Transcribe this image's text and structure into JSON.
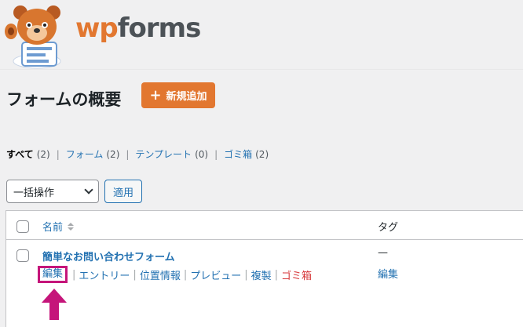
{
  "brand": {
    "part1": "wp",
    "part2": "forms"
  },
  "page": {
    "title": "フォームの概要",
    "add_new_label": "新規追加"
  },
  "filters": [
    {
      "label": "すべて",
      "count": "(2)",
      "current": true
    },
    {
      "label": "フォーム",
      "count": "(2)",
      "current": false
    },
    {
      "label": "テンプレート",
      "count": "(0)",
      "current": false
    },
    {
      "label": "ゴミ箱",
      "count": "(2)",
      "current": false
    }
  ],
  "bulk_actions": {
    "selected": "一括操作",
    "apply_label": "適用"
  },
  "table": {
    "columns": {
      "name": "名前",
      "tags": "タグ"
    },
    "rows": [
      {
        "title": "簡単なお問い合わせフォーム",
        "tag": "—",
        "tag_action": "編集",
        "actions": [
          "編集",
          "エントリー",
          "位置情報",
          "プレビュー",
          "複製",
          "ゴミ箱"
        ]
      }
    ]
  },
  "colors": {
    "accent": "#e27730",
    "link": "#2271b1",
    "trash": "#d63638",
    "highlight": "#c5157a"
  }
}
